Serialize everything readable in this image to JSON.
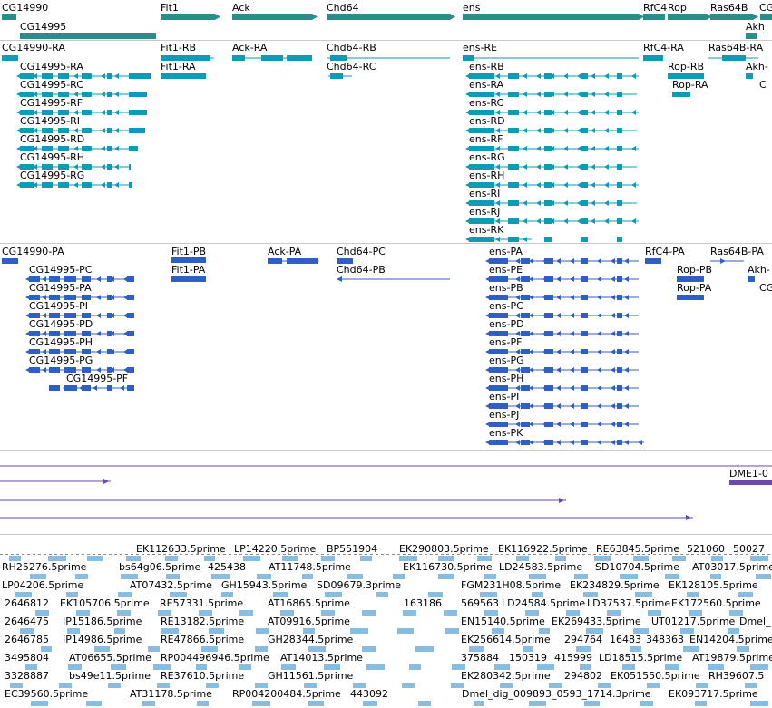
{
  "colors": {
    "gene": "#2e8b8b",
    "flybase_transcript": "#0e9bb5",
    "ensembl_transcript": "#2f5fc4",
    "cdna": "#6a4aa8",
    "est": "#87bde0",
    "separator": "#c8c8c8"
  },
  "genes": [
    {
      "label": "CG14990"
    },
    {
      "label": "CG14995"
    },
    {
      "label": "Fit1"
    },
    {
      "label": "Ack"
    },
    {
      "label": "Chd64"
    },
    {
      "label": "ens"
    },
    {
      "label": "RfC4"
    },
    {
      "label": "Rop"
    },
    {
      "label": "Ras64B"
    },
    {
      "label": "CG"
    },
    {
      "label": "Akh"
    }
  ],
  "flybase_transcripts": [
    {
      "label": "CG14990-RA"
    },
    {
      "label": "Fit1-RB"
    },
    {
      "label": "Ack-RA"
    },
    {
      "label": "Chd64-RB"
    },
    {
      "label": "ens-RE"
    },
    {
      "label": "RfC4-RA"
    },
    {
      "label": "Ras64B-RA"
    },
    {
      "label": "CG14995-RA"
    },
    {
      "label": "Fit1-RA"
    },
    {
      "label": "Chd64-RC"
    },
    {
      "label": "ens-RB"
    },
    {
      "label": "Rop-RB"
    },
    {
      "label": "Akh-"
    },
    {
      "label": "CG14995-RC"
    },
    {
      "label": "ens-RA"
    },
    {
      "label": "Rop-RA"
    },
    {
      "label": "C"
    },
    {
      "label": "CG14995-RF"
    },
    {
      "label": "ens-RC"
    },
    {
      "label": "CG14995-RI"
    },
    {
      "label": "ens-RD"
    },
    {
      "label": "CG14995-RD"
    },
    {
      "label": "ens-RF"
    },
    {
      "label": "CG14995-RH"
    },
    {
      "label": "ens-RG"
    },
    {
      "label": "CG14995-RG"
    },
    {
      "label": "ens-RH"
    },
    {
      "label": "ens-RI"
    },
    {
      "label": "ens-RJ"
    },
    {
      "label": "ens-RK"
    }
  ],
  "ensembl_transcripts": [
    {
      "label": "CG14990-PA"
    },
    {
      "label": "Fit1-PB"
    },
    {
      "label": "Ack-PA"
    },
    {
      "label": "Chd64-PC"
    },
    {
      "label": "ens-PA"
    },
    {
      "label": "RfC4-PA"
    },
    {
      "label": "Ras64B-PA"
    },
    {
      "label": "CG14995-PC"
    },
    {
      "label": "Fit1-PA"
    },
    {
      "label": "Chd64-PB"
    },
    {
      "label": "ens-PE"
    },
    {
      "label": "Rop-PB"
    },
    {
      "label": "Akh-"
    },
    {
      "label": "CG14995-PA"
    },
    {
      "label": "ens-PB"
    },
    {
      "label": "Rop-PA"
    },
    {
      "label": "CG"
    },
    {
      "label": "CG14995-PI"
    },
    {
      "label": "ens-PC"
    },
    {
      "label": "CG14995-PD"
    },
    {
      "label": "ens-PD"
    },
    {
      "label": "CG14995-PH"
    },
    {
      "label": "ens-PF"
    },
    {
      "label": "CG14995-PG"
    },
    {
      "label": "ens-PG"
    },
    {
      "label": "CG14995-PF"
    },
    {
      "label": "ens-PH"
    },
    {
      "label": "ens-PI"
    },
    {
      "label": "ens-PJ"
    },
    {
      "label": "ens-PK"
    }
  ],
  "cdna": [
    {
      "label": "DME1-0"
    }
  ],
  "est_rows": [
    [
      "EK112633.5prime",
      "LP14220.5prime",
      "BP551904",
      "EK290803.5prime",
      "EK116922.5prime",
      "RE63845.5prime",
      "521060",
      "50027"
    ],
    [
      "RH25276.5prime",
      "bs64g06.5prime",
      "425438",
      "AT11748.5prime",
      "EK116730.5prime",
      "LD24583.5prime",
      "SD10704.5prime",
      "AT03017.5prime"
    ],
    [
      "LP04206.5prime",
      "AT07432.5prime",
      "GH15943.5prime",
      "SD09679.3prime",
      "FGM231H08.5prime",
      "EK234829.5prime",
      "EK128105.5prime"
    ],
    [
      "2646812",
      "EK105706.5prime",
      "RE57331.5prime",
      "AT16865.5prime",
      "163186",
      "569563",
      "LD24584.5prime",
      "LD37537.5prime",
      "EK172560.5prime"
    ],
    [
      "2646475",
      "IP15186.5prime",
      "RE13182.5prime",
      "AT09916.5prime",
      "EN15140.5prime",
      "EK269433.5prime",
      "UT01217.5prime",
      "Dmel_"
    ],
    [
      "2646785",
      "IP14986.5prime",
      "RE47866.5prime",
      "GH28344.5prime",
      "EK256614.5prime",
      "294764",
      "16483",
      "348363",
      "EN14204.5prime"
    ],
    [
      "3495804",
      "AT06655.5prime",
      "RP004496946.5prime",
      "AT14013.5prime",
      "375884",
      "150319",
      "415999",
      "LD18515.5prime",
      "AT19879.5prime"
    ],
    [
      "3328887",
      "bs49e11.5prime",
      "RE37610.5prime",
      "GH11561.5prime",
      "EK280342.5prime",
      "294802",
      "EK051550.5prime",
      "RH39607.5"
    ],
    [
      "EC39560.5prime",
      "AT31178.5prime",
      "RP004200484.5prime",
      "443092",
      "Dmel_dig_009893_0593_1714.3prime",
      "EK093717.5prime"
    ]
  ]
}
